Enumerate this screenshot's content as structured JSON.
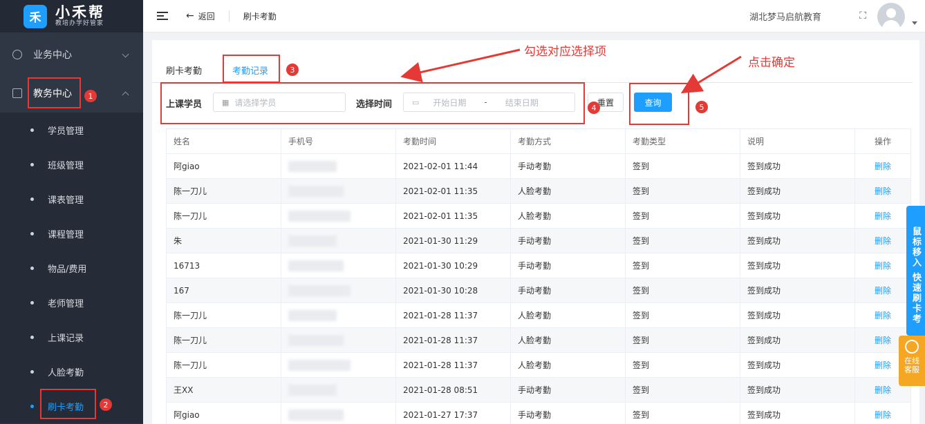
{
  "logo": {
    "mark": "禾",
    "name": "小禾帮",
    "slogan": "教培办学好管家"
  },
  "sidebar": {
    "groups": [
      {
        "label": "业务中心",
        "icon": "money-icon"
      },
      {
        "label": "教务中心",
        "icon": "book-icon"
      }
    ],
    "items": [
      {
        "label": "学员管理"
      },
      {
        "label": "班级管理"
      },
      {
        "label": "课表管理"
      },
      {
        "label": "课程管理"
      },
      {
        "label": "物品/费用"
      },
      {
        "label": "老师管理"
      },
      {
        "label": "上课记录"
      },
      {
        "label": "人脸考勤"
      },
      {
        "label": "刷卡考勤"
      }
    ],
    "active_item": "刷卡考勤"
  },
  "header": {
    "back_label": "返回",
    "breadcrumb": "刷卡考勤",
    "org_name": "湖北梦马启航教育"
  },
  "tabs": [
    {
      "label": "刷卡考勤"
    },
    {
      "label": "考勤记录"
    }
  ],
  "filter": {
    "student_label": "上课学员",
    "student_placeholder": "请选择学员",
    "time_label": "选择时间",
    "start_placeholder": "开始日期",
    "separator": "-",
    "end_placeholder": "结束日期",
    "reset_label": "重置",
    "query_label": "查询"
  },
  "table": {
    "headers": [
      "姓名",
      "手机号",
      "考勤时间",
      "考勤方式",
      "考勤类型",
      "说明",
      "操作"
    ],
    "rows": [
      {
        "name": "阿giao",
        "time": "2021-02-01 11:44",
        "method": "手动考勤",
        "type": "签到",
        "note": "签到成功",
        "action": "删除"
      },
      {
        "name": "陈一刀儿",
        "time": "2021-02-01 11:35",
        "method": "人脸考勤",
        "type": "签到",
        "note": "签到成功",
        "action": "删除"
      },
      {
        "name": "陈一刀儿",
        "time": "2021-02-01 11:35",
        "method": "人脸考勤",
        "type": "签到",
        "note": "签到成功",
        "action": "删除"
      },
      {
        "name": "朱",
        "time": "2021-01-30 11:29",
        "method": "手动考勤",
        "type": "签到",
        "note": "签到成功",
        "action": "删除"
      },
      {
        "name": "16713",
        "time": "2021-01-30 10:29",
        "method": "手动考勤",
        "type": "签到",
        "note": "签到成功",
        "action": "删除"
      },
      {
        "name": "167",
        "time": "2021-01-30 10:28",
        "method": "手动考勤",
        "type": "签到",
        "note": "签到成功",
        "action": "删除"
      },
      {
        "name": "陈一刀儿",
        "time": "2021-01-28 11:37",
        "method": "人脸考勤",
        "type": "签到",
        "note": "签到成功",
        "action": "删除"
      },
      {
        "name": "陈一刀儿",
        "time": "2021-01-28 11:37",
        "method": "人脸考勤",
        "type": "签到",
        "note": "签到成功",
        "action": "删除"
      },
      {
        "name": "陈一刀儿",
        "time": "2021-01-28 11:37",
        "method": "人脸考勤",
        "type": "签到",
        "note": "签到成功",
        "action": "删除"
      },
      {
        "name": "王XX",
        "time": "2021-01-28 08:51",
        "method": "手动考勤",
        "type": "签到",
        "note": "签到成功",
        "action": "删除"
      },
      {
        "name": "阿giao",
        "time": "2021-01-27 17:37",
        "method": "手动考勤",
        "type": "签到",
        "note": "签到成功",
        "action": "删除"
      }
    ]
  },
  "annotations": {
    "select_hint": "勾选对应选择项",
    "confirm_hint": "点击确定",
    "badges": [
      "1",
      "2",
      "3",
      "4",
      "5"
    ]
  },
  "side_widgets": {
    "quick_card": "鼠标移入 快速刷卡考",
    "service_label": "在线客服"
  },
  "colors": {
    "accent": "#1e9fff",
    "annotation": "#e53935",
    "sidebar": "#2f3744"
  }
}
